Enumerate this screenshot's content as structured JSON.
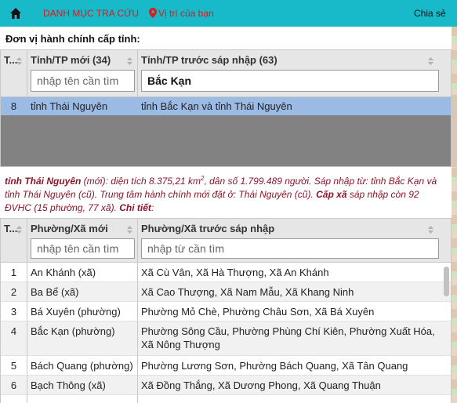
{
  "topbar": {
    "menu_label": "DANH MỤC TRA CỨU",
    "location_label": "Vị trí của bạn",
    "share_label": "Chia sẻ",
    "bg_color": "#18b9c9",
    "link_color": "#d91c1c",
    "home_icon": "home-icon",
    "pin_icon": "map-pin-icon"
  },
  "province_section": {
    "title": "Đơn vị hành chính cấp tỉnh:",
    "columns": [
      "T...",
      "Tỉnh/TP mới (34)",
      "Tỉnh/TP trước sáp nhập (63)"
    ],
    "filter_new_placeholder": "nhập tên cần tìm",
    "filter_old_value": "Bắc Kạn",
    "rows": [
      {
        "stt": "8",
        "new": "tỉnh Thái Nguyên",
        "old": "tỉnh Bắc Kạn và tỉnh Thái Nguyên"
      }
    ],
    "selected_row_color": "#9bbbe5"
  },
  "info": {
    "province_name": "tỉnh Thái Nguyên",
    "text1": " (mới): diện tích 8.375,21 km",
    "sup": "2",
    "text2": ", dân số 1.799.489 người. Sáp nhập từ: tỉnh Bắc Kạn và tỉnh Thái Nguyên (cũ). Trung tâm hành chính mới đặt ở: Thái Nguyên (cũ). ",
    "cap_xa": "Cấp xã",
    "text3": " sáp nhập còn 92 ĐVHC (15 phường, 77 xã). ",
    "detail": "Chi tiết",
    "tail": ":",
    "color": "#8a1528"
  },
  "ward_section": {
    "columns": [
      "T...",
      "Phường/Xã mới",
      "Phường/Xã trước sáp nhập"
    ],
    "filter_new_placeholder": "nhập tên cần tìm",
    "filter_old_placeholder": "nhập từ cần tìm",
    "rows": [
      {
        "stt": "1",
        "new": "An Khánh (xã)",
        "old": "Xã Cù Vân, Xã Hà Thượng, Xã An Khánh"
      },
      {
        "stt": "2",
        "new": "Ba Bể (xã)",
        "old": "Xã Cao Thượng, Xã Nam Mẫu, Xã Khang Ninh"
      },
      {
        "stt": "3",
        "new": "Bá Xuyên (phường)",
        "old": "Phường Mỏ Chè, Phường Châu Sơn, Xã Bá Xuyên"
      },
      {
        "stt": "4",
        "new": "Bắc Kạn (phường)",
        "old": "Phường Sông Cầu, Phường Phùng Chí Kiên, Phường Xuất Hóa, Xã Nông Thượng"
      },
      {
        "stt": "5",
        "new": "Bách Quang (phường)",
        "old": "Phường Lương Sơn, Phường Bách Quang, Xã Tân Quang"
      },
      {
        "stt": "6",
        "new": "Bạch Thông (xã)",
        "old": "Xã Đồng Thắng, Xã Dương Phong, Xã Quang Thuận"
      }
    ]
  }
}
